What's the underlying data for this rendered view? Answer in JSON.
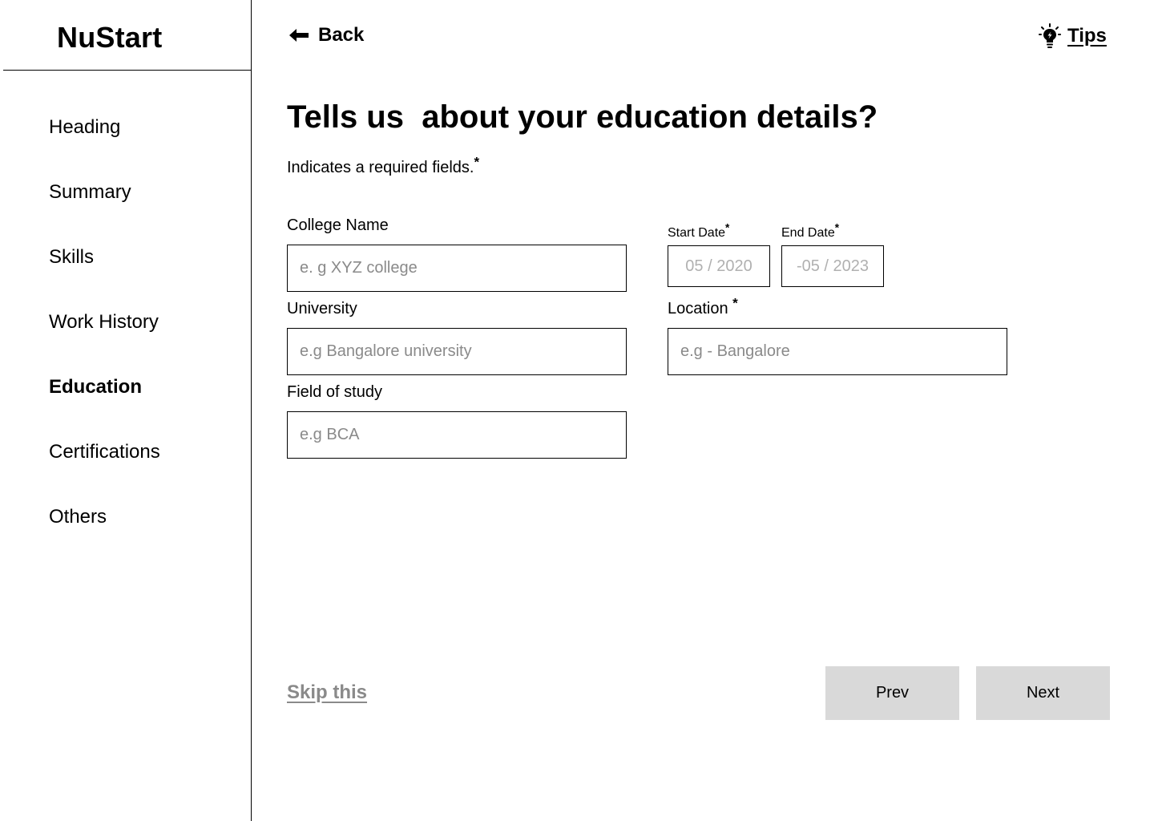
{
  "brand": {
    "title": "NuStart"
  },
  "sidebar": {
    "items": [
      {
        "label": "Heading",
        "active": false
      },
      {
        "label": "Summary",
        "active": false
      },
      {
        "label": "Skills",
        "active": false
      },
      {
        "label": "Work History",
        "active": false
      },
      {
        "label": "Education",
        "active": true
      },
      {
        "label": "Certifications",
        "active": false
      },
      {
        "label": "Others",
        "active": false
      }
    ]
  },
  "header": {
    "back_label": "Back",
    "tips_label": "Tips"
  },
  "page": {
    "title": "Tells us  about your education details?",
    "required_note": "Indicates a required fields.",
    "required_marker": "*"
  },
  "form": {
    "college": {
      "label": "College Name",
      "placeholder": "e. g XYZ college",
      "value": ""
    },
    "university": {
      "label": "University",
      "placeholder": "e.g Bangalore university",
      "value": ""
    },
    "field_of_study": {
      "label": "Field of study",
      "placeholder": "e.g BCA",
      "value": ""
    },
    "start_date": {
      "label": "Start Date",
      "placeholder": "05 / 2020",
      "value": ""
    },
    "end_date": {
      "label": "End Date",
      "placeholder": "-05 / 2023",
      "value": ""
    },
    "location": {
      "label": "Location ",
      "placeholder": "e.g - Bangalore",
      "value": ""
    }
  },
  "footer": {
    "skip_label": "Skip this",
    "prev_label": "Prev",
    "next_label": "Next"
  },
  "colors": {
    "button_bg": "#d9d9d9",
    "placeholder": "#8a8a8a",
    "skip_link": "#8a8a8a"
  },
  "icons": {
    "back": "arrow-left-icon",
    "tips": "lightbulb-icon"
  }
}
